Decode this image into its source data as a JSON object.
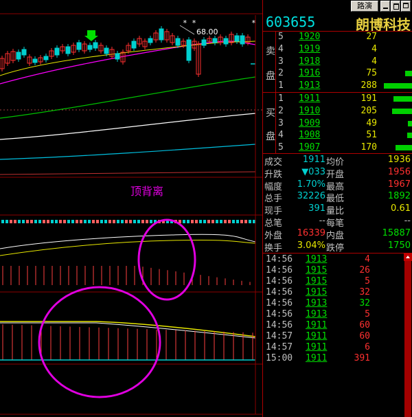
{
  "toolbar": {
    "broadcast_label": "路演"
  },
  "stock": {
    "code": "603655",
    "name": "朗博科技"
  },
  "chart_annotations": {
    "price_marker": "68.00",
    "divergence_label": "顶背离",
    "star_markers": [
      "* *",
      "*"
    ]
  },
  "colors": {
    "up": "#ff3030",
    "down": "#00d0d0",
    "flat": "#00e000",
    "volume": "#e8e800",
    "label": "#c0c0c0",
    "annotation": "#ff00ff"
  },
  "order_book": {
    "ask_label_top": "卖",
    "ask_label_bottom": "盘",
    "bid_label_top": "买",
    "bid_label_bottom": "盘",
    "asks": [
      {
        "level": "5",
        "price": "1920",
        "volume": "27",
        "bar_pct": 0
      },
      {
        "level": "4",
        "price": "1919",
        "volume": "4",
        "bar_pct": 0
      },
      {
        "level": "3",
        "price": "1918",
        "volume": "4",
        "bar_pct": 0
      },
      {
        "level": "2",
        "price": "1916",
        "volume": "75",
        "bar_pct": 26
      },
      {
        "level": "1",
        "price": "1913",
        "volume": "288",
        "bar_pct": 100
      }
    ],
    "bids": [
      {
        "level": "1",
        "price": "1911",
        "volume": "191",
        "bar_pct": 66
      },
      {
        "level": "2",
        "price": "1910",
        "volume": "205",
        "bar_pct": 71
      },
      {
        "level": "3",
        "price": "1909",
        "volume": "49",
        "bar_pct": 17
      },
      {
        "level": "4",
        "price": "1908",
        "volume": "51",
        "bar_pct": 18
      },
      {
        "level": "5",
        "price": "1907",
        "volume": "170",
        "bar_pct": 59
      }
    ]
  },
  "stats": [
    {
      "l1": "成交",
      "v1": "1911",
      "l2": "均价",
      "v2": "1936"
    },
    {
      "l1": "升跌",
      "v1": "▼033",
      "l2": "开盘",
      "v2": "1956"
    },
    {
      "l1": "幅度",
      "v1": "1.70%",
      "l2": "最高",
      "v2": "1967"
    },
    {
      "l1": "总手",
      "v1": "32226",
      "l2": "最低",
      "v2": "1892"
    },
    {
      "l1": "现手",
      "v1": "391",
      "l2": "量比",
      "v2": "0.61"
    },
    {
      "l1": "总笔",
      "v1": "--",
      "l2": "每笔",
      "v2": "--"
    },
    {
      "l1": "外盘",
      "v1": "16339",
      "l2": "内盘",
      "v2": "15887"
    },
    {
      "l1": "换手",
      "v1": "3.04%",
      "l2": "跌停",
      "v2": "1750"
    }
  ],
  "ticks": [
    {
      "time": "14:56",
      "price": "1913",
      "volume": "4",
      "dir": "up"
    },
    {
      "time": "14:56",
      "price": "1915",
      "volume": "26",
      "dir": "up"
    },
    {
      "time": "14:56",
      "price": "1915",
      "volume": "5",
      "dir": "up"
    },
    {
      "time": "14:56",
      "price": "1915",
      "volume": "32",
      "dir": "up"
    },
    {
      "time": "14:56",
      "price": "1913",
      "volume": "32",
      "dir": "flat"
    },
    {
      "time": "14:56",
      "price": "1913",
      "volume": "5",
      "dir": "up"
    },
    {
      "time": "14:56",
      "price": "1911",
      "volume": "60",
      "dir": "up"
    },
    {
      "time": "14:57",
      "price": "1911",
      "volume": "60",
      "dir": "up"
    },
    {
      "time": "14:57",
      "price": "1911",
      "volume": "6",
      "dir": "up"
    },
    {
      "time": "15:00",
      "price": "1911",
      "volume": "391",
      "dir": "up"
    }
  ]
}
